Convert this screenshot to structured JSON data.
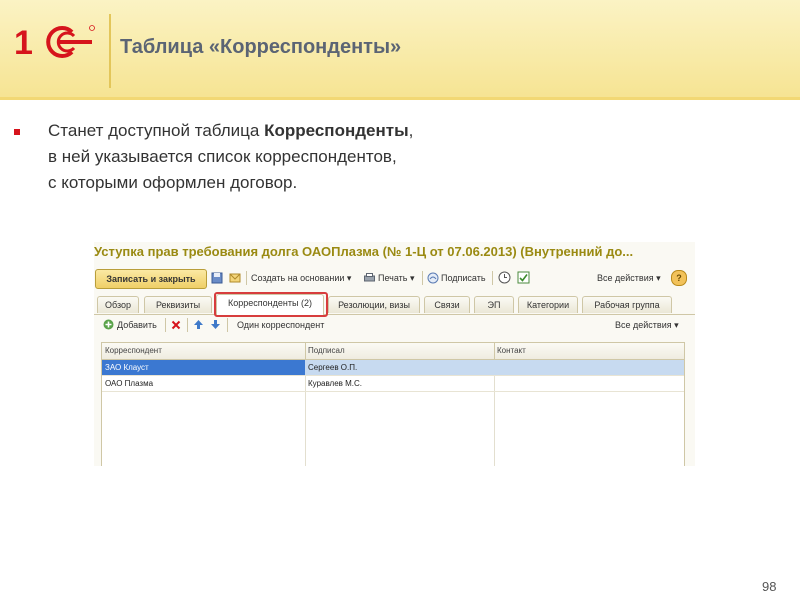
{
  "slide": {
    "title": "Таблица «Корреспонденты»",
    "body_line1_pre": "Станет доступной таблица ",
    "body_line1_bold": "Корреспонденты",
    "body_line1_post": ",",
    "body_line2": "в ней указывается список корреспондентов,",
    "body_line3": "с которыми оформлен договор.",
    "page_number": "98"
  },
  "window": {
    "title": "Уступка прав требования долга ОАОПлазма (№ 1-Ц от 07.06.2013) (Внутренний до...",
    "toolbar": {
      "save_close": "Записать и закрыть",
      "create_based": "Создать на основании",
      "print": "Печать",
      "signatures": "Подписать",
      "all_actions": "Все действия",
      "help": "?"
    },
    "tabs": [
      "Обзор",
      "Реквизиты",
      "Корреспонденты (2)",
      "Резолюции, визы",
      "Связи",
      "ЭП",
      "Категории",
      "Рабочая группа"
    ],
    "active_tab": 2,
    "subtoolbar": {
      "add": "Добавить",
      "one_correspondent": "Один корреспондент",
      "all_actions": "Все действия"
    },
    "table": {
      "columns": [
        "Корреспондент",
        "Подписал",
        "Контакт"
      ],
      "rows": [
        {
          "correspondent": "ЗАО Клауст",
          "signed": "Сергеев О.П.",
          "contact": ""
        },
        {
          "correspondent": "ОАО Плазма",
          "signed": "Куравлев М.С.",
          "contact": ""
        }
      ]
    }
  },
  "colors": {
    "header_bg": "#f6e493",
    "title_text": "#5b6474",
    "bullet": "#d6141c",
    "window_title": "#9a8a12",
    "highlight": "#d73d3d",
    "selected_row": "#c7daf0"
  }
}
